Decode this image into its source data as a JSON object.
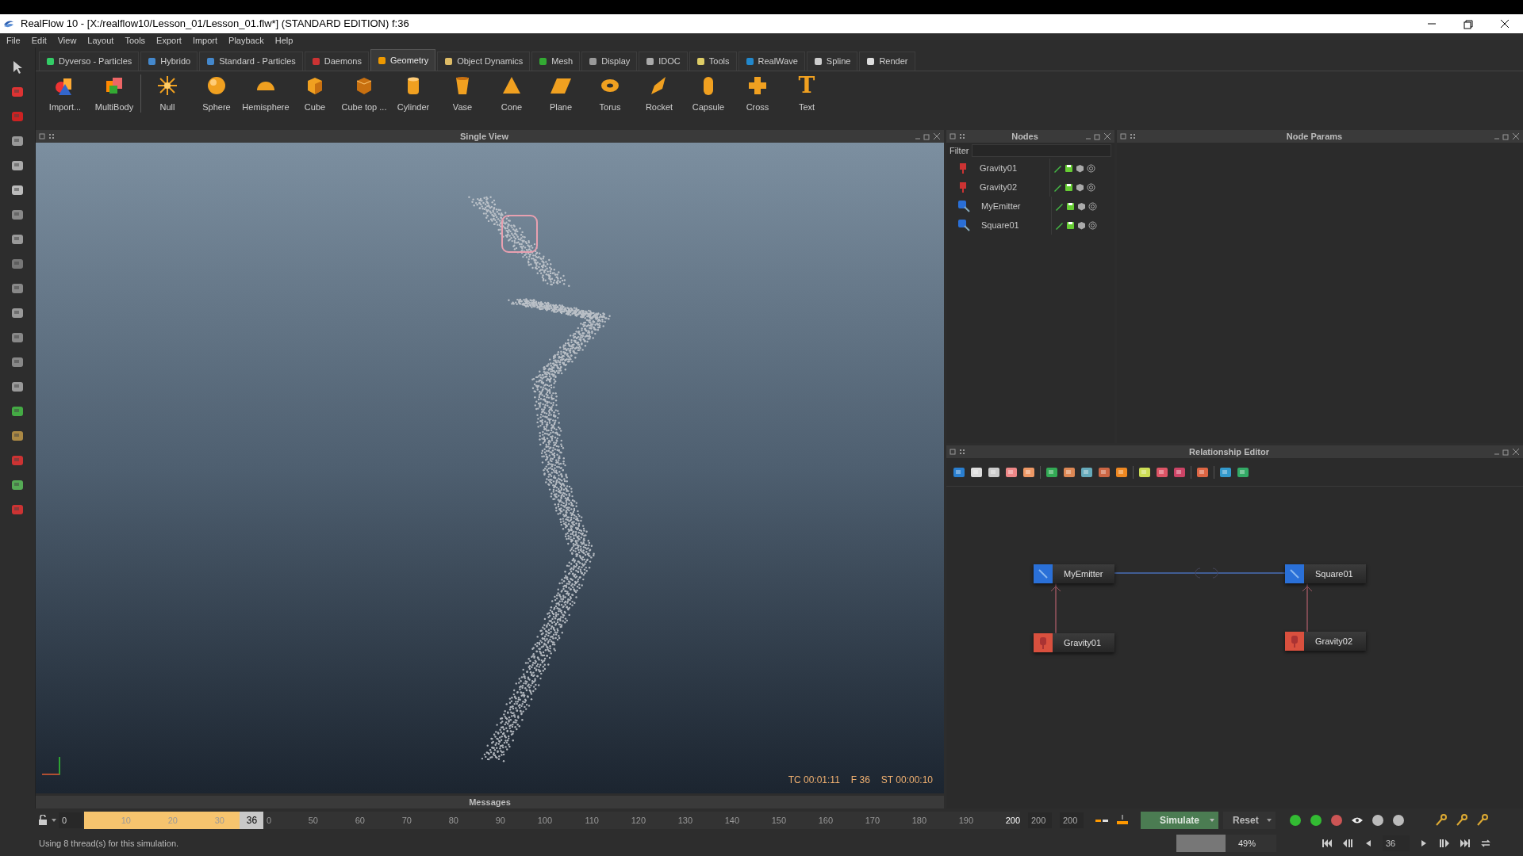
{
  "window": {
    "title": "RealFlow 10 - [X:/realflow10/Lesson_01/Lesson_01.flw*] (STANDARD EDITION) f:36"
  },
  "menu": [
    "File",
    "Edit",
    "View",
    "Layout",
    "Tools",
    "Export",
    "Import",
    "Playback",
    "Help"
  ],
  "tabs": [
    {
      "label": "Dyverso - Particles",
      "selected": false
    },
    {
      "label": "Hybrido",
      "selected": false
    },
    {
      "label": "Standard - Particles",
      "selected": false
    },
    {
      "label": "Daemons",
      "selected": false
    },
    {
      "label": "Geometry",
      "selected": true
    },
    {
      "label": "Object Dynamics",
      "selected": false
    },
    {
      "label": "Mesh",
      "selected": false
    },
    {
      "label": "Display",
      "selected": false
    },
    {
      "label": "IDOC",
      "selected": false
    },
    {
      "label": "Tools",
      "selected": false
    },
    {
      "label": "RealWave",
      "selected": false
    },
    {
      "label": "Spline",
      "selected": false
    },
    {
      "label": "Render",
      "selected": false
    }
  ],
  "shelf": [
    {
      "label": "Import..."
    },
    {
      "label": "MultiBody"
    },
    {
      "label": "Null"
    },
    {
      "label": "Sphere"
    },
    {
      "label": "Hemisphere"
    },
    {
      "label": "Cube"
    },
    {
      "label": "Cube top ..."
    },
    {
      "label": "Cylinder"
    },
    {
      "label": "Vase"
    },
    {
      "label": "Cone"
    },
    {
      "label": "Plane"
    },
    {
      "label": "Torus"
    },
    {
      "label": "Rocket"
    },
    {
      "label": "Capsule"
    },
    {
      "label": "Cross"
    },
    {
      "label": "Text",
      "glyph": "T"
    }
  ],
  "viewport": {
    "title": "Single View",
    "timecode": "TC 00:01:11",
    "frame": "F 36",
    "sim_time": "ST 00:00:10"
  },
  "messages": {
    "title": "Messages"
  },
  "nodes_panel": {
    "title": "Nodes",
    "filter_label": "Filter",
    "items": [
      {
        "name": "Gravity01",
        "kind": "daemon"
      },
      {
        "name": "Gravity02",
        "kind": "daemon"
      },
      {
        "name": "MyEmitter",
        "kind": "emitter"
      },
      {
        "name": "Square01",
        "kind": "emitter"
      }
    ]
  },
  "node_params": {
    "title": "Node Params"
  },
  "relationship_editor": {
    "title": "Relationship Editor",
    "nodes": [
      {
        "name": "MyEmitter",
        "kind": "emitter"
      },
      {
        "name": "Square01",
        "kind": "emitter"
      },
      {
        "name": "Gravity01",
        "kind": "daemon"
      },
      {
        "name": "Gravity02",
        "kind": "daemon"
      }
    ]
  },
  "timeline": {
    "start": "0",
    "ticks": [
      "10",
      "20",
      "30",
      "0",
      "50",
      "60",
      "70",
      "80",
      "90",
      "100",
      "110",
      "120",
      "130",
      "140",
      "150",
      "160",
      "170",
      "180",
      "190",
      "200"
    ],
    "current": "36",
    "level": 0.18,
    "end_fields": [
      "200",
      "200"
    ]
  },
  "simulate": {
    "label": "Simulate"
  },
  "reset": {
    "label": "Reset"
  },
  "progress": {
    "level": 0.49,
    "text": "49%"
  },
  "frame_field": "36",
  "status": "Using 8 thread(s) for this simulation."
}
